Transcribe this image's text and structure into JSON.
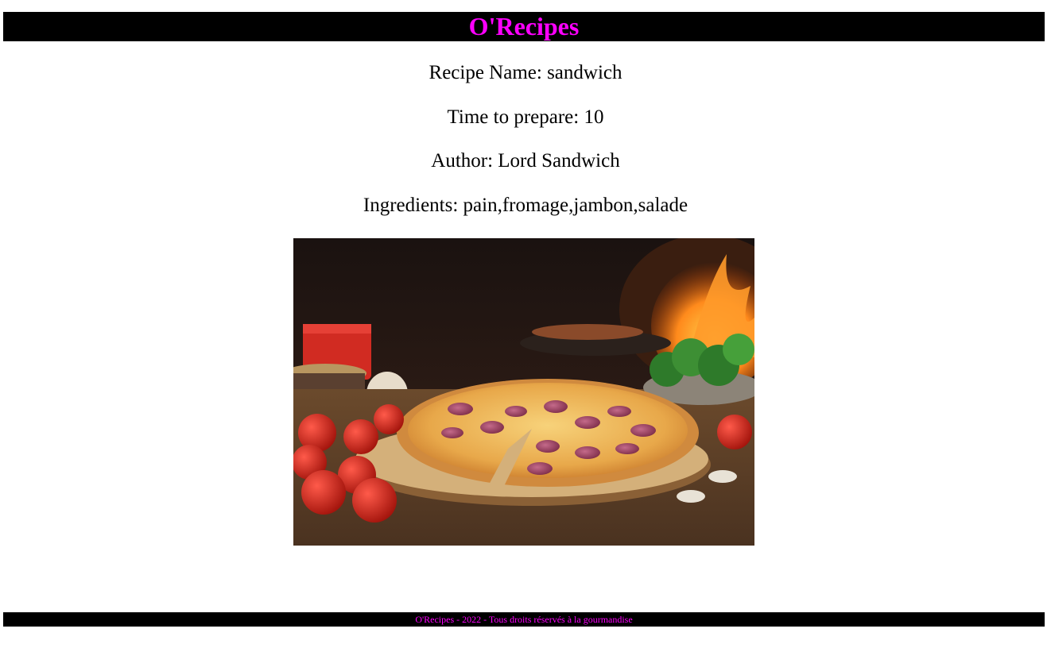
{
  "header": {
    "title": "O'Recipes"
  },
  "recipe": {
    "name_line": "Recipe Name: sandwich",
    "time_line": "Time to prepare: 10",
    "author_line": "Author: Lord Sandwich",
    "ingredients_line": "Ingredients: pain,fromage,jambon,salade",
    "image_subject": "pizza-photo"
  },
  "footer": {
    "text": "O'Recipes - 2022 - Tous droits réservés à la gourmandise"
  },
  "colors": {
    "bar_background": "#000000",
    "brand_magenta": "#ff00ff",
    "page_background": "#ffffff"
  }
}
